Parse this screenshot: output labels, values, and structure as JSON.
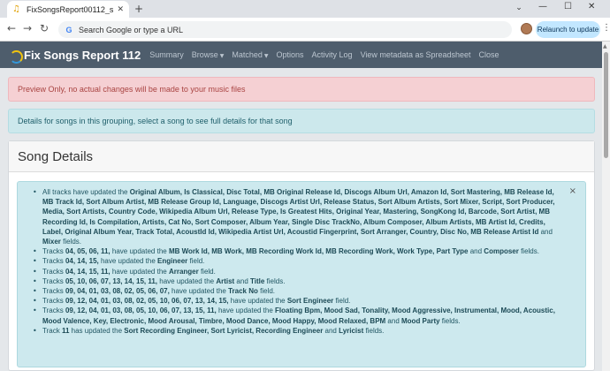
{
  "browser": {
    "tab_title": "FixSongsReport00112_songdet",
    "address_placeholder": "Search Google or type a URL",
    "relaunch_label": "Relaunch to update"
  },
  "app": {
    "brand": "Fix Songs Report 112",
    "nav": [
      {
        "label": "Summary",
        "dropdown": false
      },
      {
        "label": "Browse",
        "dropdown": true
      },
      {
        "label": "Matched",
        "dropdown": true
      },
      {
        "label": "Options",
        "dropdown": false
      },
      {
        "label": "Activity Log",
        "dropdown": false
      },
      {
        "label": "View metadata as Spreadsheet",
        "dropdown": false
      },
      {
        "label": "Close",
        "dropdown": false
      }
    ]
  },
  "alerts": {
    "preview": "Preview Only, no actual changes will be made to your music files",
    "info": "Details for songs in this grouping, select a song to see full details for that song"
  },
  "card": {
    "title": "Song Details",
    "close_glyph": "×",
    "items": [
      [
        {
          "t": "All tracks have updated the "
        },
        {
          "t": "Original Album, Is Classical, Disc Total, MB Original Release Id, Discogs Album Url, Amazon Id, Sort Mastering, MB Release Id, MB Track Id, Sort Album Artist, MB Release Group Id, Language, Discogs Artist Url, Release Status, Sort Album Artists, Sort Mixer, Script, Sort Producer, Media, Sort Artists, Country Code, Wikipedia Album Url, Release Type, Is Greatest Hits, Original Year, Mastering, SongKong Id, Barcode, Sort Artist, MB Recording Id, Is Compilation, Artists, Cat No, Sort Composer, Album Year, Single Disc TrackNo, Album Composer, Album Artists, MB Artist Id, Credits, Label, Original Album Year, Track Total, AcoustId Id, Wikipedia Artist Url, Acoustid Fingerprint, Sort Arranger, Country, Disc No, MB Release Artist Id",
          "b": true
        },
        {
          "t": " and "
        },
        {
          "t": "Mixer",
          "b": true
        },
        {
          "t": " fields."
        }
      ],
      [
        {
          "t": "Tracks "
        },
        {
          "t": "04, 05, 06, 11,",
          "b": true
        },
        {
          "t": " have updated the "
        },
        {
          "t": "MB Work Id, MB Work, MB Recording Work Id, MB Recording Work, Work Type, Part Type",
          "b": true
        },
        {
          "t": " and "
        },
        {
          "t": "Composer",
          "b": true
        },
        {
          "t": " fields."
        }
      ],
      [
        {
          "t": "Tracks "
        },
        {
          "t": "04, 14, 15,",
          "b": true
        },
        {
          "t": " have updated the "
        },
        {
          "t": "Engineer",
          "b": true
        },
        {
          "t": " field."
        }
      ],
      [
        {
          "t": "Tracks "
        },
        {
          "t": "04, 14, 15, 11,",
          "b": true
        },
        {
          "t": " have updated the "
        },
        {
          "t": "Arranger",
          "b": true
        },
        {
          "t": " field."
        }
      ],
      [
        {
          "t": "Tracks "
        },
        {
          "t": "05, 10, 06, 07, 13, 14, 15, 11,",
          "b": true
        },
        {
          "t": " have updated the "
        },
        {
          "t": "Artist",
          "b": true
        },
        {
          "t": " and "
        },
        {
          "t": "Title",
          "b": true
        },
        {
          "t": " fields."
        }
      ],
      [
        {
          "t": "Tracks "
        },
        {
          "t": "09, 04, 01, 03, 08, 02, 05, 06, 07,",
          "b": true
        },
        {
          "t": " have updated the "
        },
        {
          "t": "Track No",
          "b": true
        },
        {
          "t": " field."
        }
      ],
      [
        {
          "t": "Tracks "
        },
        {
          "t": "09, 12, 04, 01, 03, 08, 02, 05, 10, 06, 07, 13, 14, 15,",
          "b": true
        },
        {
          "t": " have updated the "
        },
        {
          "t": "Sort Engineer",
          "b": true
        },
        {
          "t": " field."
        }
      ],
      [
        {
          "t": "Tracks "
        },
        {
          "t": "09, 12, 04, 01, 03, 08, 05, 10, 06, 07, 13, 15, 11,",
          "b": true
        },
        {
          "t": " have updated the "
        },
        {
          "t": "Floating Bpm, Mood Sad, Tonality, Mood Aggressive, Instrumental, Mood, Acoustic, Mood Valence, Key, Electronic, Mood Arousal, Timbre, Mood Dance, Mood Happy, Mood Relaxed, BPM",
          "b": true
        },
        {
          "t": " and "
        },
        {
          "t": "Mood Party",
          "b": true
        },
        {
          "t": " fields."
        }
      ],
      [
        {
          "t": "Track "
        },
        {
          "t": "11",
          "b": true
        },
        {
          "t": " has updated the "
        },
        {
          "t": "Sort Recording Engineer, Sort Lyricist, Recording Engineer",
          "b": true
        },
        {
          "t": " and "
        },
        {
          "t": "Lyricist",
          "b": true
        },
        {
          "t": " fields."
        }
      ]
    ]
  }
}
